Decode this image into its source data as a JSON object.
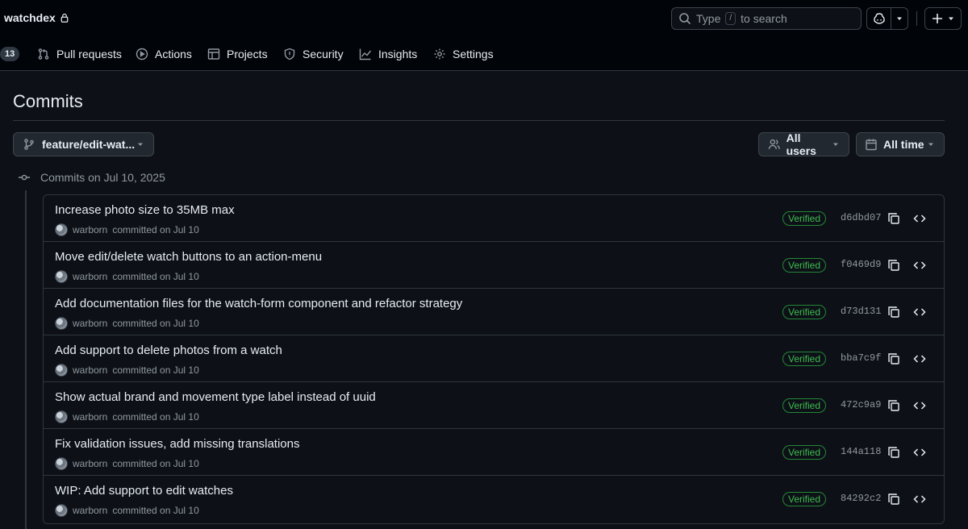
{
  "repo": {
    "name": "watchdex"
  },
  "search": {
    "prefix": "Type",
    "key": "/",
    "suffix": "to search"
  },
  "nav": {
    "badge_count": "13",
    "tabs": [
      {
        "label": "Pull requests",
        "icon": "git-pull-request-icon"
      },
      {
        "label": "Actions",
        "icon": "play-icon"
      },
      {
        "label": "Projects",
        "icon": "table-icon"
      },
      {
        "label": "Security",
        "icon": "shield-icon"
      },
      {
        "label": "Insights",
        "icon": "graph-icon"
      },
      {
        "label": "Settings",
        "icon": "gear-icon"
      }
    ]
  },
  "page": {
    "title": "Commits"
  },
  "filters": {
    "branch": "feature/edit-wat...",
    "users": "All users",
    "time": "All time"
  },
  "timeline": {
    "date_header": "Commits on Jul 10, 2025"
  },
  "commits": [
    {
      "title": "Increase photo size to 35MB max",
      "author": "warborn",
      "meta": "committed on Jul 10",
      "badge": "Verified",
      "sha": "d6dbd07"
    },
    {
      "title": "Move edit/delete watch buttons to an action-menu",
      "author": "warborn",
      "meta": "committed on Jul 10",
      "badge": "Verified",
      "sha": "f0469d9"
    },
    {
      "title": "Add documentation files for the watch-form component and refactor strategy",
      "author": "warborn",
      "meta": "committed on Jul 10",
      "badge": "Verified",
      "sha": "d73d131"
    },
    {
      "title": "Add support to delete photos from a watch",
      "author": "warborn",
      "meta": "committed on Jul 10",
      "badge": "Verified",
      "sha": "bba7c9f"
    },
    {
      "title": "Show actual brand and movement type label instead of uuid",
      "author": "warborn",
      "meta": "committed on Jul 10",
      "badge": "Verified",
      "sha": "472c9a9"
    },
    {
      "title": "Fix validation issues, add missing translations",
      "author": "warborn",
      "meta": "committed on Jul 10",
      "badge": "Verified",
      "sha": "144a118"
    },
    {
      "title": "WIP: Add support to edit watches",
      "author": "warborn",
      "meta": "committed on Jul 10",
      "badge": "Verified",
      "sha": "84292c2"
    }
  ],
  "colors": {
    "background": "#0d1117",
    "header": "#010409",
    "border": "#30363d",
    "verified_green": "#3fb950"
  }
}
